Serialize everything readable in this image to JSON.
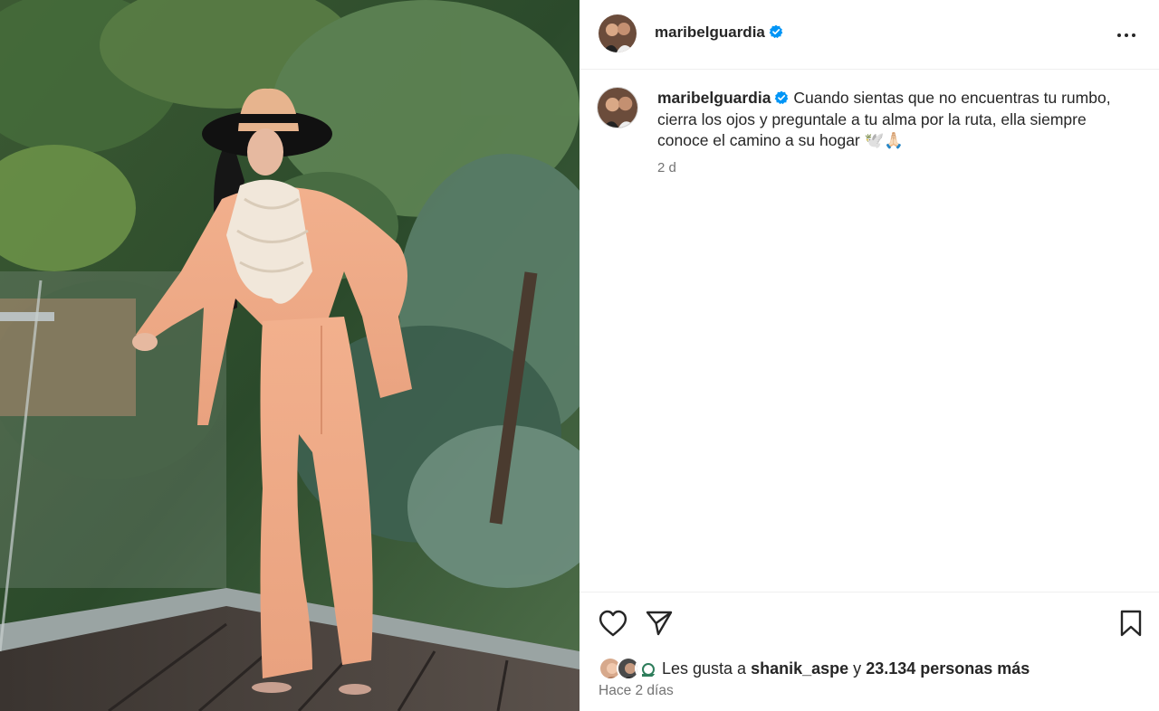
{
  "post": {
    "username": "maribelguardia",
    "verified": true,
    "caption": "Cuando sientas que no encuentras tu rumbo, cierra los ojos y preguntale a tu alma por la ruta, ella siempre conoce el camino a su hogar",
    "caption_emoji": "🕊️🙏🏻",
    "relative_time": "2 d"
  },
  "likes": {
    "prefix": "Les gusta a",
    "first_user": "shanik_aspe",
    "connector": "y",
    "others": "23.134 personas más"
  },
  "date": "Hace 2 días",
  "icons": {
    "more": "more-options-icon",
    "verified": "verified-badge-icon",
    "like": "heart-icon",
    "share": "share-icon",
    "save": "bookmark-icon"
  },
  "colors": {
    "verified": "#0095f6",
    "text": "#262626",
    "muted": "#737373"
  }
}
